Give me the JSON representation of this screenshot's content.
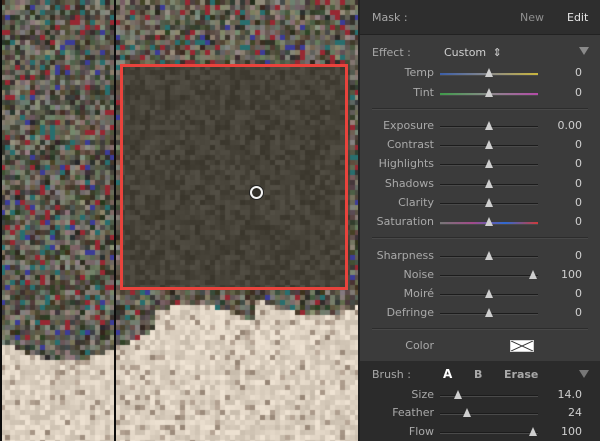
{
  "mask": {
    "label": "Mask :",
    "new": "New",
    "edit": "Edit"
  },
  "effect": {
    "label": "Effect :",
    "value": "Custom",
    "arrow": "⇕"
  },
  "sliders": [
    {
      "name": "Temp",
      "label": "Temp",
      "value": "0",
      "pos": 0.5,
      "track": "temp"
    },
    {
      "name": "Tint",
      "label": "Tint",
      "value": "0",
      "pos": 0.5,
      "track": "tint"
    },
    {
      "name": "Exposure",
      "label": "Exposure",
      "value": "0.00",
      "pos": 0.5,
      "track": "plain"
    },
    {
      "name": "Contrast",
      "label": "Contrast",
      "value": "0",
      "pos": 0.5,
      "track": "plain"
    },
    {
      "name": "Highlights",
      "label": "Highlights",
      "value": "0",
      "pos": 0.5,
      "track": "plain"
    },
    {
      "name": "Shadows",
      "label": "Shadows",
      "value": "0",
      "pos": 0.5,
      "track": "plain"
    },
    {
      "name": "Clarity",
      "label": "Clarity",
      "value": "0",
      "pos": 0.5,
      "track": "plain"
    },
    {
      "name": "Saturation",
      "label": "Saturation",
      "value": "0",
      "pos": 0.5,
      "track": "sat"
    },
    {
      "name": "Sharpness",
      "label": "Sharpness",
      "value": "0",
      "pos": 0.5,
      "track": "plain"
    },
    {
      "name": "Noise",
      "label": "Noise",
      "value": "100",
      "pos": 0.95,
      "track": "plain"
    },
    {
      "name": "Moire",
      "label": "Moiré",
      "value": "0",
      "pos": 0.5,
      "track": "plain"
    },
    {
      "name": "Defringe",
      "label": "Defringe",
      "value": "0",
      "pos": 0.5,
      "track": "plain"
    }
  ],
  "color": {
    "label": "Color"
  },
  "brush": {
    "label": "Brush :",
    "a": "A",
    "b": "B",
    "erase": "Erase"
  },
  "brush_sliders": [
    {
      "name": "Size",
      "label": "Size",
      "value": "14.0",
      "pos": 0.18
    },
    {
      "name": "Feather",
      "label": "Feather",
      "value": "24",
      "pos": 0.28
    },
    {
      "name": "Flow",
      "label": "Flow",
      "value": "100",
      "pos": 0.95
    }
  ],
  "colors": {
    "accent_red": "#e8433c",
    "panel": "#3b3b3b"
  }
}
